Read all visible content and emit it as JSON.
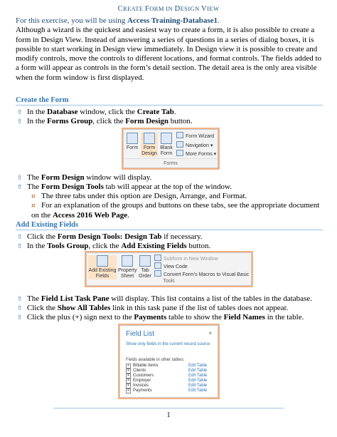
{
  "title": {
    "p1": "C",
    "p2": "REATE ",
    "p3": "F",
    "p4": "ORM IN ",
    "p5": "D",
    "p6": "ESIGN ",
    "p7": "V",
    "p8": "IEW"
  },
  "intro": {
    "lead": "For this exercise, you will be using ",
    "db": "Access Training-Database1",
    "lead_end": ".",
    "body": "Although a wizard is the quickest and easiest way to create a form, it is also possible to create a form in Design View. Instead of answering a series of questions in a series of dialog boxes, it is possible to start working in Design view immediately. In Design view it is possible to create and modify controls, move the controls to different locations, and format controls. The fields added to a form will appear as controls in the form’s detail section. The detail area is the only area visible when the form window is first displayed."
  },
  "section1": {
    "heading": "Create the Form",
    "b1": {
      "a": "In the ",
      "b": "Database",
      "c": " window, click the ",
      "d": "Create Tab",
      "e": "."
    },
    "b2": {
      "a": "In the ",
      "b": "Forms Group",
      "c": ", click the ",
      "d": "Form Design",
      "e": " button."
    },
    "ribbon": {
      "form": "Form",
      "form_design_1": "Form",
      "form_design_2": "Design",
      "blank_1": "Blank",
      "blank_2": "Form",
      "wizard": "Form Wizard",
      "navigation": "Navigation ▾",
      "more": "More Forms ▾",
      "group": "Forms"
    },
    "b3": {
      "a": "The ",
      "b": "Form Design",
      "c": " window will display."
    },
    "b4": {
      "a": "The ",
      "b": "Form Design Tools",
      "c": " tab will appear at the top of the window."
    },
    "s1": "The three tabs under this option are Design, Arrange, and Format.",
    "s2": {
      "a": "For an explanation of the groups and buttons on these tabs, see the appropriate document on the ",
      "b": "Access 2016 Web Page",
      "c": "."
    }
  },
  "section2": {
    "heading": "Add Existing Fields",
    "b1": {
      "a": "Click the ",
      "b": "Form Design Tools: Design Tab",
      "c": " if necessary."
    },
    "b2": {
      "a": "In the ",
      "b": "Tools Group",
      "c": ", click the ",
      "d": "Add Existing Fields",
      "e": " button."
    },
    "ribbon": {
      "add_1": "Add Existing",
      "add_2": "Fields",
      "prop_1": "Property",
      "prop_2": "Sheet",
      "tab_1": "Tab",
      "tab_2": "Order",
      "subform": "Subform in New Window",
      "view_code": "View Code",
      "convert": "Convert Form's Macros to Visual Basic",
      "group": "Tools"
    },
    "b3": {
      "a": "The ",
      "b": "Field List Task Pane",
      "c": " will display. This list contains a list of the tables in the database."
    },
    "b4": {
      "a": "Click the ",
      "b": "Show All Tables",
      "c": " link in this task pane if the list of tables does not appear."
    },
    "b5": {
      "a": "Click the plus (+) sign next to the ",
      "b": "Payments",
      "c": " table to show the ",
      "d": "Field Names",
      "e": " in the table."
    },
    "field_list": {
      "title": "Field List",
      "close": "×",
      "link": "Show only fields in the current record source",
      "header": "Fields available in other tables:",
      "rows": [
        {
          "name": "Billable Items",
          "action": "Edit Table"
        },
        {
          "name": "Clients",
          "action": "Edit Table"
        },
        {
          "name": "Customers",
          "action": "Edit Table"
        },
        {
          "name": "Employer",
          "action": "Edit Table"
        },
        {
          "name": "Invoices",
          "action": "Edit Table"
        },
        {
          "name": "Payments",
          "action": "Edit Table"
        }
      ]
    }
  },
  "page_number": "1"
}
